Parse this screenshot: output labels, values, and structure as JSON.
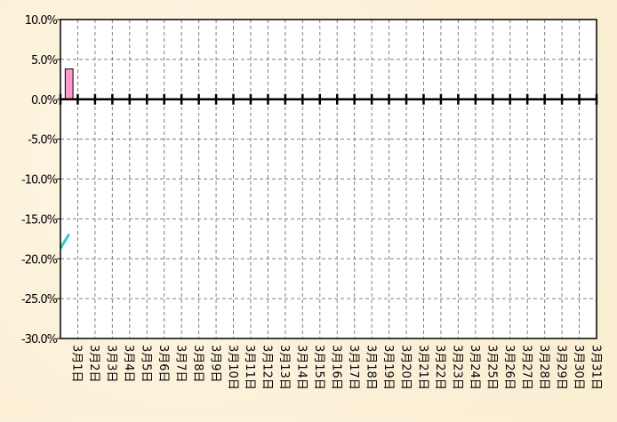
{
  "chart_data": {
    "type": "bar",
    "title": "",
    "xlabel": "",
    "ylabel": "",
    "ylim": [
      -30,
      10
    ],
    "y_ticks": [
      "10.0%",
      "5.0%",
      "0.0%",
      "-5.0%",
      "-10.0%",
      "-15.0%",
      "-20.0%",
      "-25.0%",
      "-30.0%"
    ],
    "y_tick_values": [
      10,
      5,
      0,
      -5,
      -10,
      -15,
      -20,
      -25,
      -30
    ],
    "categories": [
      "3月1日",
      "3月2日",
      "3月3日",
      "3月4日",
      "3月5日",
      "3月6日",
      "3月7日",
      "3月8日",
      "3月9日",
      "3月10日",
      "3月11日",
      "3月12日",
      "3月13日",
      "3月14日",
      "3月15日",
      "3月16日",
      "3月17日",
      "3月18日",
      "3月19日",
      "3月20日",
      "3月21日",
      "3月22日",
      "3月23日",
      "3月24日",
      "3月25日",
      "3月26日",
      "3月27日",
      "3月28日",
      "3月29日",
      "3月30日",
      "3月31日"
    ],
    "grid": true,
    "series": [
      {
        "name": "bar",
        "type": "bar",
        "color": "#ff99cc",
        "values": [
          3.8,
          null,
          null,
          null,
          null,
          null,
          null,
          null,
          null,
          null,
          null,
          null,
          null,
          null,
          null,
          null,
          null,
          null,
          null,
          null,
          null,
          null,
          null,
          null,
          null,
          null,
          null,
          null,
          null,
          null,
          null
        ]
      },
      {
        "name": "line",
        "type": "line",
        "color": "#33cccc",
        "start_value": -18.7,
        "values": [
          -16.9,
          null,
          null,
          null,
          null,
          null,
          null,
          null,
          null,
          null,
          null,
          null,
          null,
          null,
          null,
          null,
          null,
          null,
          null,
          null,
          null,
          null,
          null,
          null,
          null,
          null,
          null,
          null,
          null,
          null,
          null
        ]
      }
    ]
  }
}
